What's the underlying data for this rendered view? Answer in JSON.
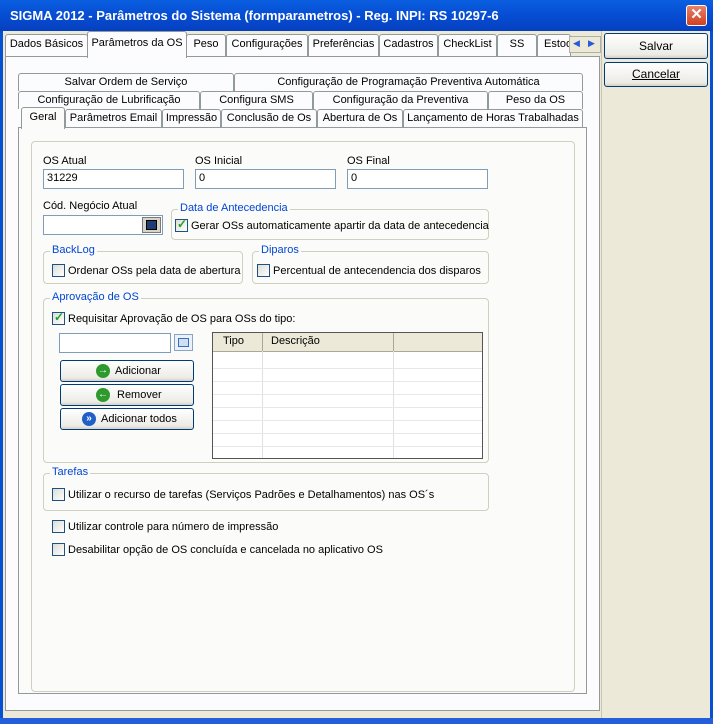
{
  "window": {
    "title": "SIGMA 2012 - Parâmetros do Sistema  (formparametros)  - Reg. INPI: RS 10297-6",
    "close_glyph": "✕"
  },
  "main_tabs": [
    "Dados Básicos",
    "Parâmetros da OS",
    "Peso",
    "Configurações",
    "Preferências",
    "Cadastros",
    "CheckList",
    "SS",
    "Estoq"
  ],
  "main_tabs_selected": "Parâmetros da OS",
  "tab_scroll": {
    "left": "◀",
    "right": "▶"
  },
  "buttons": {
    "save": "Salvar",
    "cancel": "Cancelar"
  },
  "sub_tabs": {
    "row1": [
      "Salvar Ordem de Serviço",
      "Configuração de Programação Preventiva Automática"
    ],
    "row2": [
      "Configuração de Lubrificação",
      "Configura SMS",
      "Configuração da Preventiva",
      "Peso da OS"
    ],
    "row3": [
      "Geral",
      "Parâmetros Email",
      "Impressão",
      "Conclusão de Os",
      "Abertura de Os",
      "Lançamento de Horas Trabalhadas"
    ],
    "selected": "Geral"
  },
  "fields": {
    "os_atual": {
      "label": "OS Atual",
      "value": "31229"
    },
    "os_inicial": {
      "label": "OS Inicial",
      "value": "0"
    },
    "os_final": {
      "label": "OS Final",
      "value": "0"
    },
    "cod_negocio": {
      "label": "Cód. Negócio Atual",
      "value": ""
    }
  },
  "groups": {
    "antecedencia": {
      "caption": "Data de Antecedencia",
      "check_label": "Gerar OSs automaticamente apartir da data de antecedencia",
      "checked": true
    },
    "backlog": {
      "caption": "BackLog",
      "check_label": "Ordenar OSs pela data de abertura",
      "checked": false
    },
    "diparos": {
      "caption": "Diparos",
      "check_label": "Percentual de antecendencia dos disparos",
      "checked": false
    },
    "aprovacao": {
      "caption": "Aprovação de OS",
      "check_label": "Requisitar Aprovação de OS para OSs do tipo:",
      "checked": true,
      "buttons": {
        "add": "Adicionar",
        "remove": "Remover",
        "add_all": "Adicionar todos"
      },
      "grid_columns": [
        "Tipo",
        "Descrição"
      ]
    },
    "tarefas": {
      "caption": "Tarefas",
      "check_label": "Utilizar o recurso de tarefas (Serviços Padrões e Detalhamentos) nas OS´s",
      "checked": false
    }
  },
  "options": {
    "controle_impressao": {
      "label": "Utilizar controle para número de impressão",
      "checked": false
    },
    "desabilitar_opcao": {
      "label": "Desabilitar opção de OS concluída e cancelada no aplicativo OS",
      "checked": false
    }
  },
  "colors": {
    "titlebar": "#0750d6",
    "group_caption": "#0046d5",
    "panel": "#fbfbf9",
    "dialog": "#ece9d8"
  }
}
